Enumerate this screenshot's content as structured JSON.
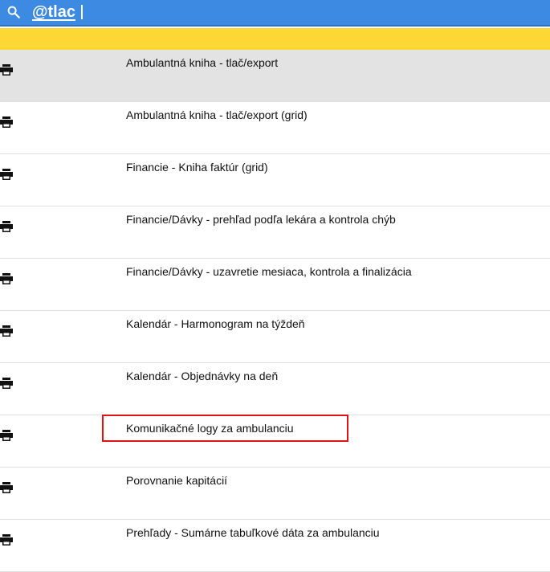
{
  "search": {
    "query": "@tlac"
  },
  "colors": {
    "header": "#3c8ae2",
    "banner": "#fdd835",
    "selected_row": "#e3e3e3",
    "highlight": "#e01212"
  },
  "list": {
    "items": [
      {
        "label": "Ambulantná kniha - tlač/export",
        "icon": "printer-icon",
        "selected": true
      },
      {
        "label": "Ambulantná kniha - tlač/export (grid)",
        "icon": "printer-icon"
      },
      {
        "label": "Financie - Kniha faktúr (grid)",
        "icon": "printer-icon"
      },
      {
        "label": "Financie/Dávky - prehľad podľa lekára a kontrola chýb",
        "icon": "printer-icon"
      },
      {
        "label": "Financie/Dávky - uzavretie mesiaca, kontrola a finalizácia",
        "icon": "printer-icon"
      },
      {
        "label": "Kalendár - Harmonogram na týždeň",
        "icon": "printer-icon"
      },
      {
        "label": "Kalendár - Objednávky na deň",
        "icon": "printer-icon"
      },
      {
        "label": "Komunikačné logy za ambulanciu",
        "icon": "printer-icon",
        "highlighted": true
      },
      {
        "label": "Porovnanie kapitácií",
        "icon": "printer-icon"
      },
      {
        "label": "Prehľady - Sumárne tabuľkové dáta za ambulanciu",
        "icon": "printer-icon"
      }
    ]
  }
}
